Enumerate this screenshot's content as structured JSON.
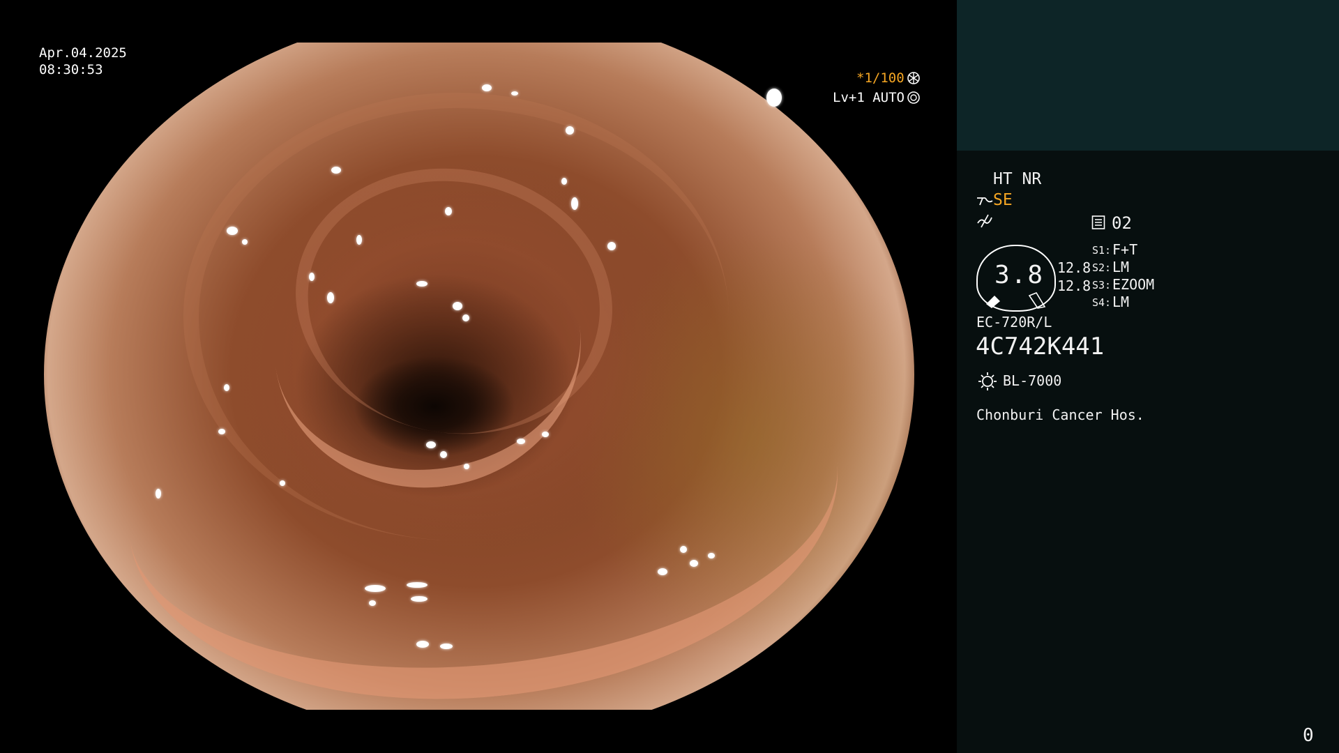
{
  "overlay": {
    "date": "Apr.04.2025",
    "time": "08:30:53",
    "shutter": "*1/100",
    "level": "Lv+1 AUTO"
  },
  "panel": {
    "mode1": "HT NR",
    "mode2": "SE",
    "memory": "02",
    "gauge_value": "3.8",
    "gauge_side_1": "12.8",
    "gauge_side_2": "12.8",
    "switches": [
      {
        "key": "S1:",
        "value": "F+T"
      },
      {
        "key": "S2:",
        "value": "LM"
      },
      {
        "key": "S3:",
        "value": "EZOOM"
      },
      {
        "key": "S4:",
        "value": "LM"
      }
    ],
    "scope_model": "EC-720R/L",
    "serial": "4C742K441",
    "light_source": "BL-7000",
    "hospital": "Chonburi Cancer Hos.",
    "counter": "0"
  },
  "colors": {
    "accent": "#f5a623",
    "panel_top": "#0d2527",
    "panel_bg": "#070f0f"
  },
  "icons": [
    "shutter-icon",
    "auto-iris-icon",
    "structure-enhance-icon",
    "noise-icon",
    "memory-icon",
    "gauge-icon",
    "light-source-icon"
  ]
}
